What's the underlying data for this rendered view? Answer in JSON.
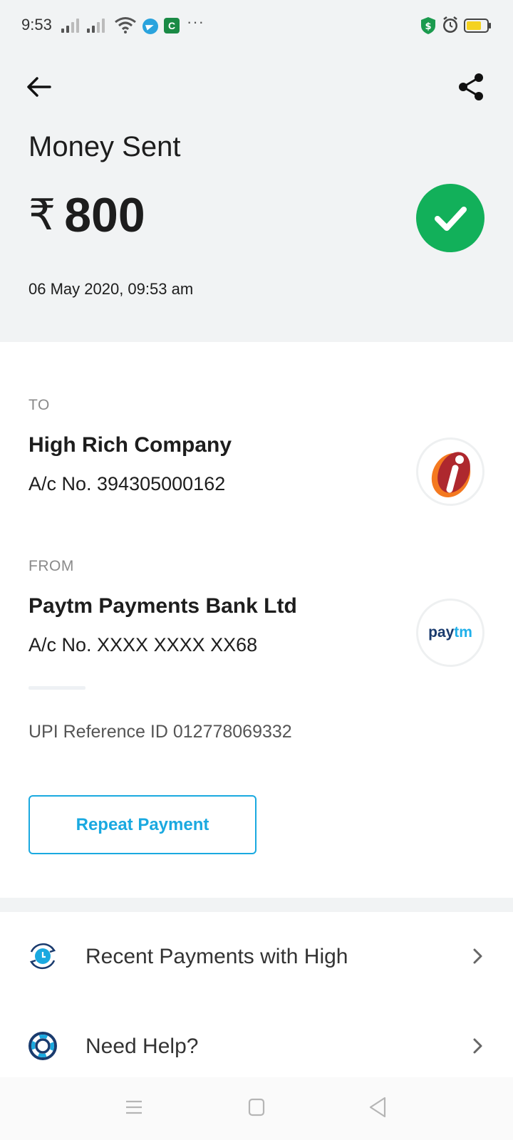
{
  "status_bar": {
    "time": "9:53",
    "icons": [
      "signal-icon",
      "signal-icon",
      "wifi-icon",
      "telegram-icon",
      "app-notification-icon",
      "more-icon",
      "security-shield-icon",
      "alarm-icon",
      "battery-icon"
    ],
    "more": "···",
    "app_icon_glyph": "C"
  },
  "header": {
    "title": "Money Sent",
    "currency_symbol": "₹",
    "amount": "800",
    "datetime": "06 May 2020, 09:53 am",
    "status": "success",
    "colors": {
      "success": "#12b05a",
      "background": "#f1f3f4"
    }
  },
  "to": {
    "label": "TO",
    "name": "High Rich Company",
    "account": "A/c No. 394305000162",
    "logo": "icici-bank-logo"
  },
  "from": {
    "label": "FROM",
    "name": "Paytm Payments Bank Ltd",
    "account": "A/c No. XXXX XXXX XX68",
    "logo": {
      "pay": "pay",
      "tm": "tm"
    }
  },
  "upi_reference": "UPI Reference ID 012778069332",
  "repeat_button": {
    "label": "Repeat Payment",
    "color": "#1aa9e0"
  },
  "list": [
    {
      "label": "Recent Payments with High",
      "icon": "recent-payments-icon"
    },
    {
      "label": "Need Help?",
      "icon": "help-lifebuoy-icon"
    }
  ],
  "nav": [
    "menu-icon",
    "home-icon",
    "back-icon"
  ]
}
